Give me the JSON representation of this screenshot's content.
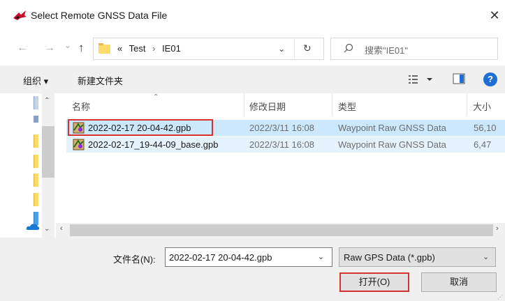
{
  "window": {
    "title": "Select Remote GNSS Data File",
    "close_label": "✕"
  },
  "nav": {
    "back": "←",
    "forward": "→",
    "history": "⌄",
    "up": "↑"
  },
  "address": {
    "overflow": "«",
    "crumbs": [
      "Test",
      "IE01"
    ],
    "separator": "›",
    "dropdown": "⌄",
    "refresh": "↻"
  },
  "search": {
    "placeholder": "搜索\"IE01\""
  },
  "toolbar": {
    "organize_label": "组织 ▾",
    "new_folder_label": "新建文件夹",
    "help_label": "?"
  },
  "columns": {
    "name": "名称",
    "date": "修改日期",
    "type": "类型",
    "size": "大小"
  },
  "files": [
    {
      "name": "2022-02-17 20-04-42.gpb",
      "date": "2022/3/11 16:08",
      "type": "Waypoint Raw GNSS Data",
      "size": "56,10"
    },
    {
      "name": "2022-02-17_19-44-09_base.gpb",
      "date": "2022/3/11 16:08",
      "type": "Waypoint Raw GNSS Data",
      "size": "6,47"
    }
  ],
  "footer": {
    "filename_label": "文件名(N):",
    "filename_value": "2022-02-17 20-04-42.gpb",
    "filetype_value": "Raw GPS Data (*.gpb)",
    "open_label": "打开(O)",
    "cancel_label": "取消"
  },
  "colors": {
    "selected_row": "#cce8ff",
    "highlight_box": "#d93030",
    "help_icon": "#1d6fd6"
  }
}
